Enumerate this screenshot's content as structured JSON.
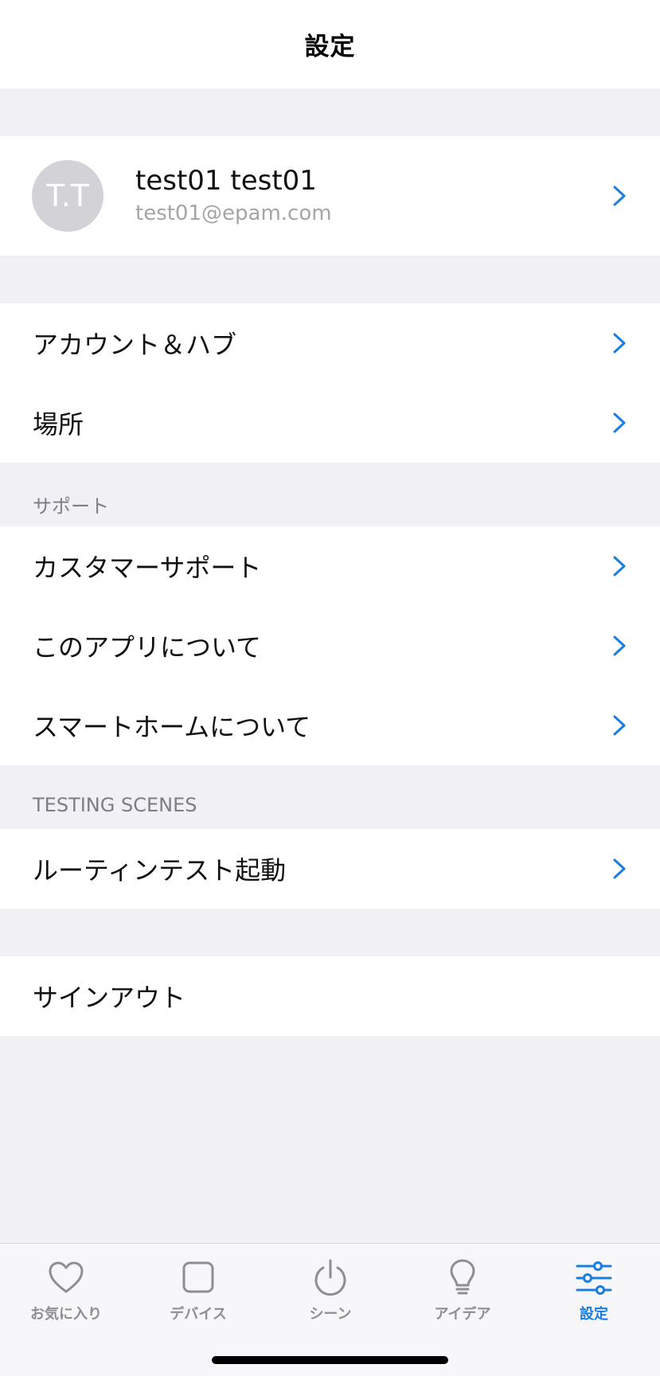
{
  "header": {
    "title": "設定"
  },
  "profile": {
    "initials": "T.T",
    "name": "test01 test01",
    "email": "test01@epam.com"
  },
  "account_group": [
    {
      "label": "アカウント＆ハブ"
    },
    {
      "label": "場所"
    }
  ],
  "support": {
    "header": "サポート",
    "items": [
      {
        "label": "カスタマーサポート"
      },
      {
        "label": "このアプリについて"
      },
      {
        "label": "スマートホームについて"
      }
    ]
  },
  "testing": {
    "header": "TESTING SCENES",
    "items": [
      {
        "label": "ルーティンテスト起動"
      }
    ]
  },
  "sign_out": {
    "label": "サインアウト"
  },
  "tabbar": {
    "tabs": [
      {
        "label": "お気に入り",
        "icon": "heart-icon"
      },
      {
        "label": "デバイス",
        "icon": "device-square-icon"
      },
      {
        "label": "シーン",
        "icon": "power-icon"
      },
      {
        "label": "アイデア",
        "icon": "lightbulb-icon"
      },
      {
        "label": "設定",
        "icon": "sliders-icon"
      }
    ],
    "active_index": 4
  },
  "colors": {
    "accent": "#1a7de0",
    "background": "#f0f0f5",
    "chevron": "#1a7de0"
  }
}
